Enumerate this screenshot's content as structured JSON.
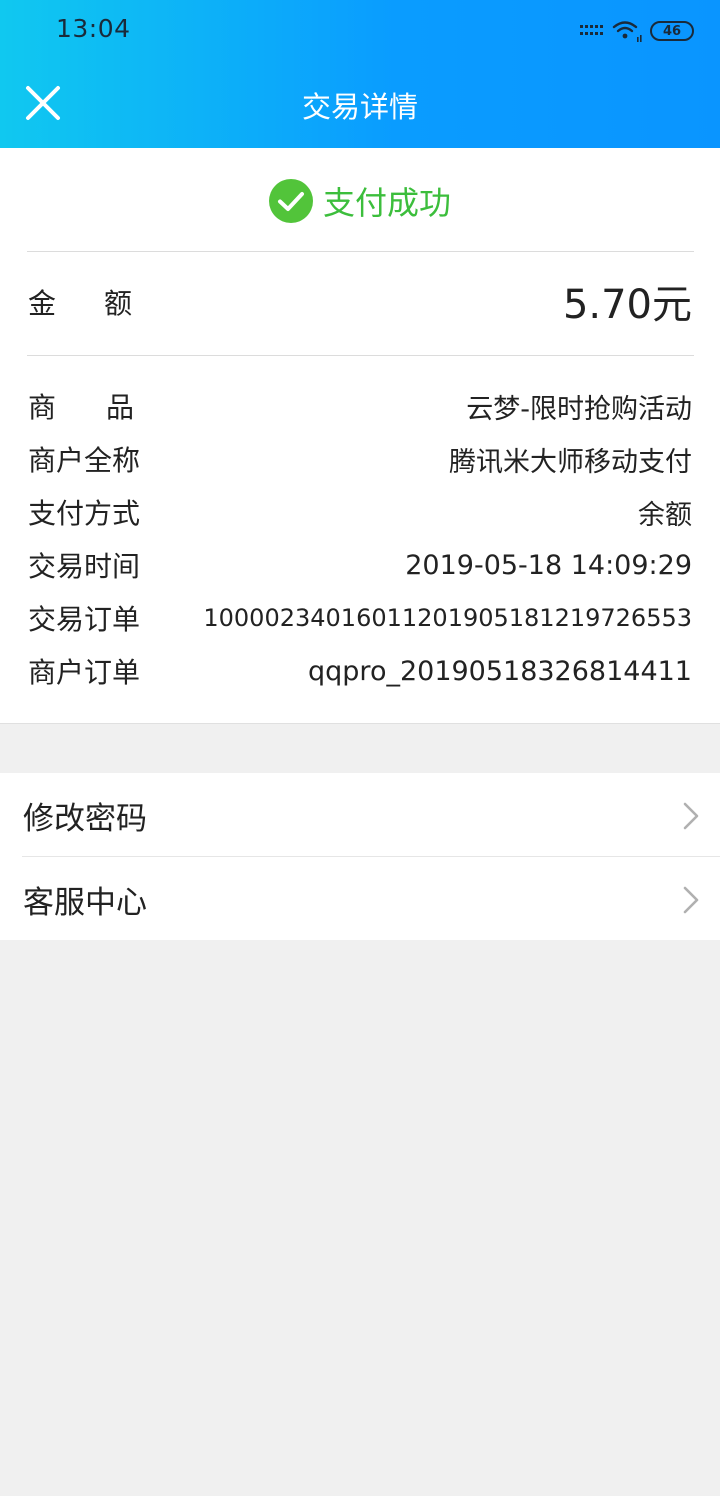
{
  "status_bar": {
    "time": "13:04",
    "battery": "46"
  },
  "nav": {
    "title": "交易详情",
    "close_icon": "close-icon"
  },
  "status": {
    "text": "支付成功",
    "icon": "check-circle-icon",
    "color": "#3cbe3c"
  },
  "amount": {
    "label": "金额",
    "value": "5.70元"
  },
  "details": [
    {
      "label": "商品",
      "value": "云梦-限时抢购活动"
    },
    {
      "label": "商户全称",
      "value": "腾讯米大师移动支付"
    },
    {
      "label": "支付方式",
      "value": "余额"
    },
    {
      "label": "交易时间",
      "value": "2019-05-18 14:09:29"
    },
    {
      "label": "交易订单",
      "value": "100002340160112019051812197265​53"
    },
    {
      "label": "商户订单",
      "value": "qqpro_20190518326814411"
    }
  ],
  "menu": [
    {
      "label": "修改密码",
      "icon": "chevron-right-icon"
    },
    {
      "label": "客服中心",
      "icon": "chevron-right-icon"
    }
  ],
  "colors": {
    "header_start": "#10c8f0",
    "header_end": "#0a95ff",
    "success": "#3cbe3c",
    "background": "#f0f0f0"
  }
}
